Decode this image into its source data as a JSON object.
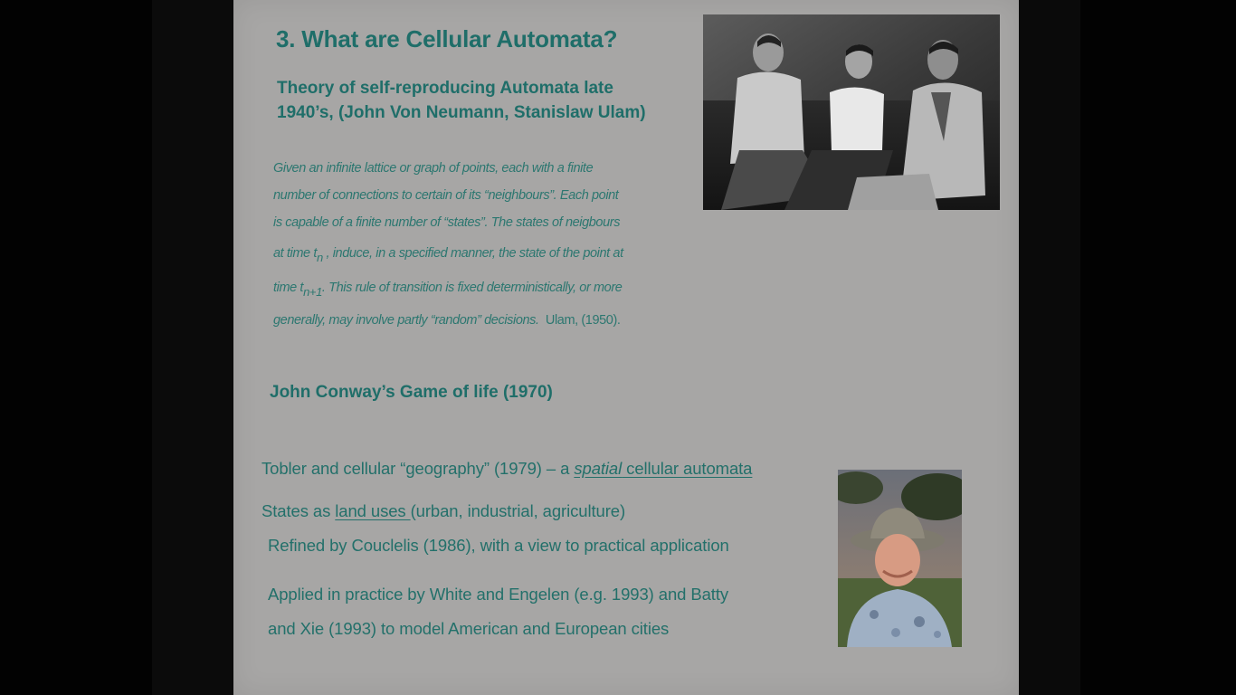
{
  "slide": {
    "title": "3. What are Cellular Automata?",
    "subtitle_line1": "Theory of self-reproducing Automata late",
    "subtitle_line2": "1940’s, (John Von Neumann, Stanislaw Ulam)",
    "quote": {
      "line1": "Given an infinite lattice or graph of points, each with a finite",
      "line2": "number of connections to certain of its “neighbours”. Each point",
      "line3": "is capable of a finite number of “states”. The states of neigbours",
      "line4_a": "at time t",
      "line4_sub": "n",
      "line4_b": " , induce, in a specified manner, the state of the point at",
      "line5_a": "time t",
      "line5_sub": "n+1",
      "line5_b": ". This rule of transition is fixed deterministically, or more",
      "line6_a": "generally, may involve partly “random” decisions.",
      "line6_b": "Ulam, (1950)."
    },
    "conway": "John Conway’s Game of life (1970)",
    "tobler": {
      "a": "Tobler and cellular “geography” (1979) – a ",
      "spatial": "spatial",
      "b": " cellular automata"
    },
    "states": {
      "a": "States as ",
      "land_uses": "land uses ",
      "b": "(urban, industrial, agriculture)"
    },
    "couclelis": "Refined by Couclelis (1986), with a view to practical application",
    "applied_line1": "Applied in practice by White and Engelen (e.g. 1993) and Batty",
    "applied_line2": "and Xie (1993) to model American and European cities"
  },
  "colors": {
    "slide_bg": "#a7a6a5",
    "teal": "#1f6e69"
  }
}
